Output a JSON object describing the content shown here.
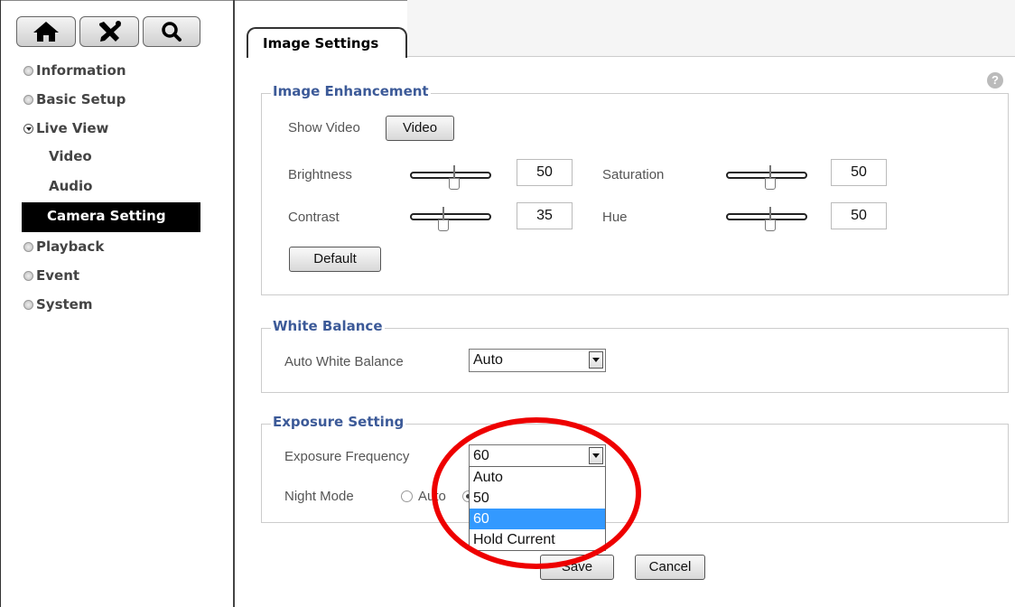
{
  "toolbar": {
    "icons": [
      "home-icon",
      "tools-icon",
      "search-icon"
    ]
  },
  "sidebar": {
    "items": [
      {
        "label": "Information"
      },
      {
        "label": "Basic Setup"
      },
      {
        "label": "Live View"
      },
      {
        "label": "Playback"
      },
      {
        "label": "Event"
      },
      {
        "label": "System"
      }
    ],
    "sub_items": [
      "Video",
      "Audio",
      "Camera Setting"
    ],
    "active_sub_item": "Camera Setting"
  },
  "tab": {
    "label": "Image Settings"
  },
  "help": {
    "glyph": "?"
  },
  "image_enhancement": {
    "legend": "Image Enhancement",
    "show_video_label": "Show Video",
    "video_button": "Video",
    "brightness": {
      "label": "Brightness",
      "value": "50",
      "level": 0.5
    },
    "contrast": {
      "label": "Contrast",
      "value": "35",
      "level": 0.35
    },
    "saturation": {
      "label": "Saturation",
      "value": "50",
      "level": 0.5
    },
    "hue": {
      "label": "Hue",
      "value": "50",
      "level": 0.5
    },
    "default_button": "Default"
  },
  "white_balance": {
    "legend": "White Balance",
    "auto_label": "Auto White Balance",
    "selected": "Auto"
  },
  "exposure": {
    "legend": "Exposure Setting",
    "frequency_label": "Exposure Frequency",
    "frequency_selected": "60",
    "frequency_options": [
      "Auto",
      "50",
      "60",
      "Hold Current"
    ],
    "night_mode_label": "Night Mode",
    "night_mode_option_auto": "Auto"
  },
  "actions": {
    "save": "Save",
    "cancel": "Cancel"
  },
  "annotation": {
    "color": "#ee0000"
  }
}
